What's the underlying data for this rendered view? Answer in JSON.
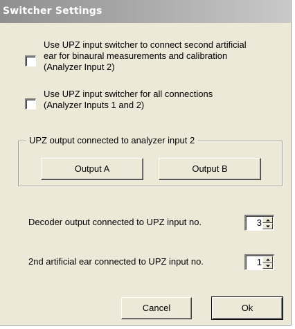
{
  "window": {
    "title": "Switcher Settings"
  },
  "options": {
    "binaural": {
      "line1": "Use UPZ input switcher to connect second artificial",
      "line2": "ear for binaural measurements and calibration",
      "line3": "(Analyzer Input 2)",
      "checked": false
    },
    "all_connections": {
      "line1": "Use UPZ input switcher for all connections",
      "line2": "(Analyzer Inputs 1 and 2)",
      "checked": false
    }
  },
  "output_group": {
    "legend": "UPZ output connected to analyzer input 2",
    "output_a_label": "Output A",
    "output_b_label": "Output B"
  },
  "decoder": {
    "label": "Decoder output connected to UPZ input no.",
    "value": "3"
  },
  "second_ear": {
    "label": "2nd artificial ear connected to UPZ input no.",
    "value": "1"
  },
  "footer": {
    "cancel_label": "Cancel",
    "ok_label": "Ok"
  },
  "colors": {
    "dialog_bg": "#ece9d8",
    "title_text": "#ffffff"
  },
  "icons": {
    "spin_up": "triangle-up-icon",
    "spin_down": "triangle-down-icon"
  }
}
